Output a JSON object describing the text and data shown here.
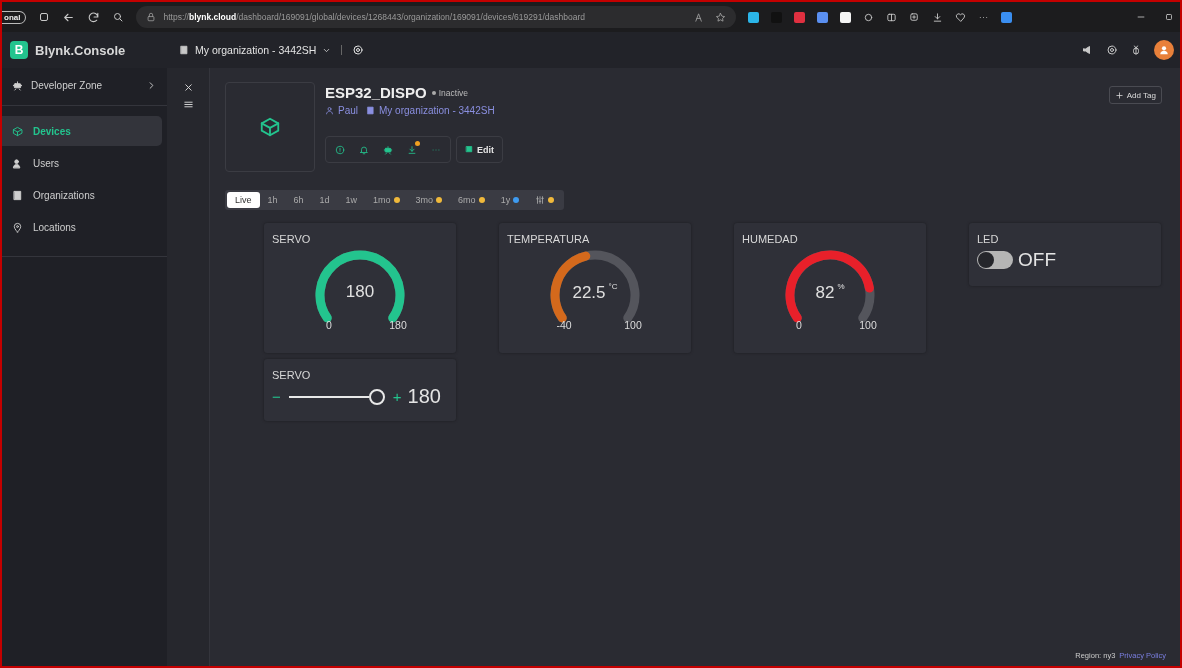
{
  "browser": {
    "tab_label": "onal",
    "url": "https://**blynk.cloud**/dashboard/169091/global/devices/1268443/organization/169091/devices/619291/dashboard"
  },
  "header": {
    "logo_letter": "B",
    "brand": "Blynk.Console",
    "organization": "My organization - 3442SH"
  },
  "sidebar": {
    "zone": "Developer Zone",
    "items": [
      {
        "label": "Devices",
        "kind": "devices",
        "selected": true
      },
      {
        "label": "Users",
        "kind": "users",
        "selected": false
      },
      {
        "label": "Organizations",
        "kind": "organizations",
        "selected": false
      },
      {
        "label": "Locations",
        "kind": "locations",
        "selected": false
      }
    ]
  },
  "device": {
    "name": "ESP32_DISPO",
    "status": "Inactive",
    "owner": "Paul",
    "organization": "My organization - 3442SH",
    "edit": "Edit",
    "add_tag": "Add Tag"
  },
  "time_ranges": [
    {
      "label": "Live",
      "selected": true
    },
    {
      "label": "1h",
      "selected": false
    },
    {
      "label": "6h",
      "selected": false
    },
    {
      "label": "1d",
      "selected": false
    },
    {
      "label": "1w",
      "selected": false
    },
    {
      "label": "1mo",
      "selected": false,
      "color": "#f0b93b"
    },
    {
      "label": "3mo",
      "selected": false,
      "color": "#f0b93b"
    },
    {
      "label": "6mo",
      "selected": false,
      "color": "#f0b93b"
    },
    {
      "label": "1y",
      "selected": false,
      "color": "#3e9bf0"
    },
    {
      "kind": "custom",
      "selected": false,
      "color": "#f0b93b"
    }
  ],
  "widgets": [
    {
      "kind": "gauge",
      "title": "SERVO",
      "value": "180",
      "min": "0",
      "max": "180",
      "color": "#23c48e"
    },
    {
      "kind": "gauge",
      "title": "TEMPERATURA",
      "value": "22.5",
      "unit": "°C",
      "min": "-40",
      "max": "100",
      "color": "#d4691c"
    },
    {
      "kind": "gauge",
      "title": "HUMEDAD",
      "value": "82",
      "unit": "%",
      "min": "0",
      "max": "100",
      "color": "#e8202a"
    },
    {
      "kind": "switch",
      "title": "LED",
      "on": false,
      "state_label": "OFF"
    },
    {
      "kind": "slider",
      "title": "SERVO",
      "minus": "−",
      "plus": "+",
      "value": "180",
      "level": 1.0
    }
  ],
  "footer": {
    "region": "Region: ny3",
    "link": "Privacy Policy"
  }
}
